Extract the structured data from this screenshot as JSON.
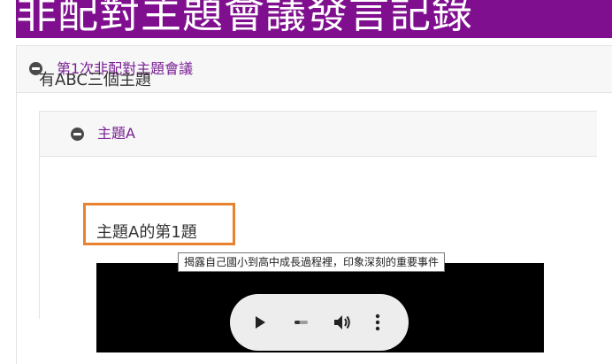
{
  "page": {
    "title": "非配對主題會議發言記錄"
  },
  "meeting": {
    "title": "第1次非配對主題會議",
    "description": "有ABC三個主題"
  },
  "topic": {
    "title": "主題A",
    "question_title": "主題A的第1題",
    "question_tooltip": "揭露自己國小到高中成長過程裡，印象深刻的重要事件"
  },
  "player": {
    "progress": 0.4,
    "icons": [
      "play-icon",
      "volume-icon",
      "more-vert-icon"
    ]
  },
  "colors": {
    "banner": "#800f8f",
    "accent_text": "#7a1f94",
    "highlight_box": "#e8822f"
  }
}
